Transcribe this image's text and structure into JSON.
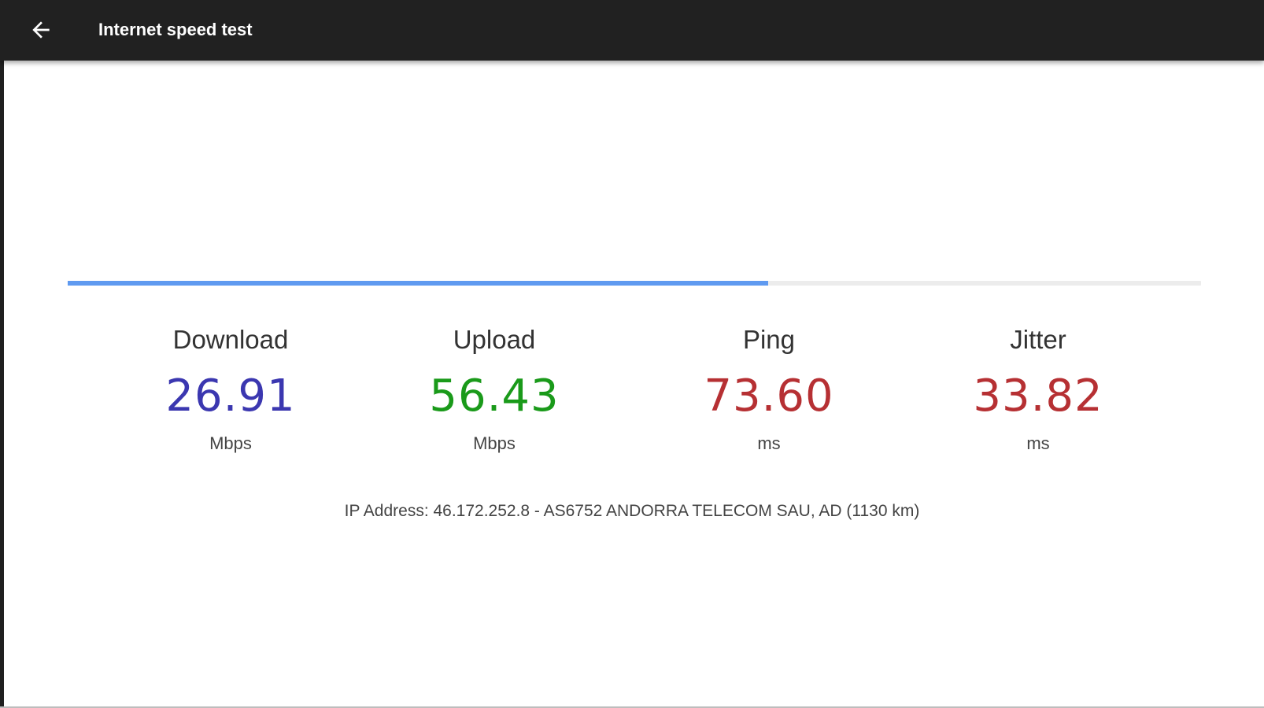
{
  "toolbar": {
    "title": "Internet speed test",
    "back_icon": "arrow-back-icon"
  },
  "progress": {
    "fraction": 0.618,
    "fill_color": "#5f9af0",
    "track_color": "#ececec"
  },
  "metrics": [
    {
      "label": "Download",
      "value": "26.91",
      "unit": "Mbps",
      "color": "#3b37b0"
    },
    {
      "label": "Upload",
      "value": "56.43",
      "unit": "Mbps",
      "color": "#1a9a1a"
    },
    {
      "label": "Ping",
      "value": "73.60",
      "unit": "ms",
      "color": "#b63033"
    },
    {
      "label": "Jitter",
      "value": "33.82",
      "unit": "ms",
      "color": "#b63033"
    }
  ],
  "ip_info": "IP Address: 46.172.252.8 - AS6752 ANDORRA TELECOM SAU, AD (1130 km)"
}
